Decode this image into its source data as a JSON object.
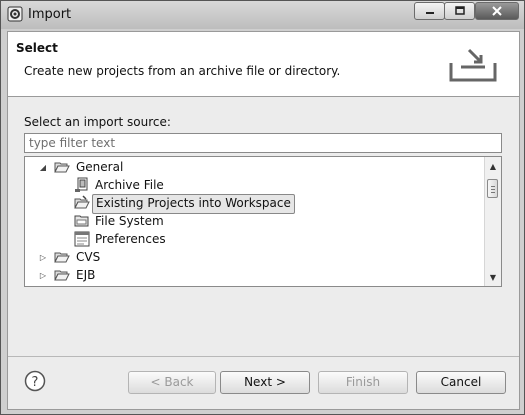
{
  "window": {
    "title": "Import",
    "controls": [
      "minimize-icon",
      "maximize-icon",
      "close-icon"
    ]
  },
  "banner": {
    "title": "Select",
    "description": "Create new projects from an archive file or directory.",
    "icon": "import-tray-icon"
  },
  "source": {
    "label": "Select an import source:",
    "filter_placeholder": "type filter text",
    "filter_value": ""
  },
  "tree": {
    "items": [
      {
        "label": "General",
        "expanded": true,
        "icon": "folder-open-icon"
      },
      {
        "label": "Archive File",
        "icon": "archive-file-icon"
      },
      {
        "label": "Existing Projects into Workspace",
        "icon": "projects-folder-icon",
        "selected": true
      },
      {
        "label": "File System",
        "icon": "file-system-icon"
      },
      {
        "label": "Preferences",
        "icon": "preferences-icon"
      },
      {
        "label": "CVS",
        "expanded": false,
        "icon": "folder-icon"
      },
      {
        "label": "EJB",
        "expanded": false,
        "icon": "folder-icon"
      }
    ]
  },
  "buttons": {
    "back": "< Back",
    "next": "Next >",
    "finish": "Finish",
    "cancel": "Cancel"
  },
  "colors": {
    "titlebar": "#c8c8c8",
    "dialog_bg": "#ececec",
    "selection_bg": "#e6e6e6"
  }
}
